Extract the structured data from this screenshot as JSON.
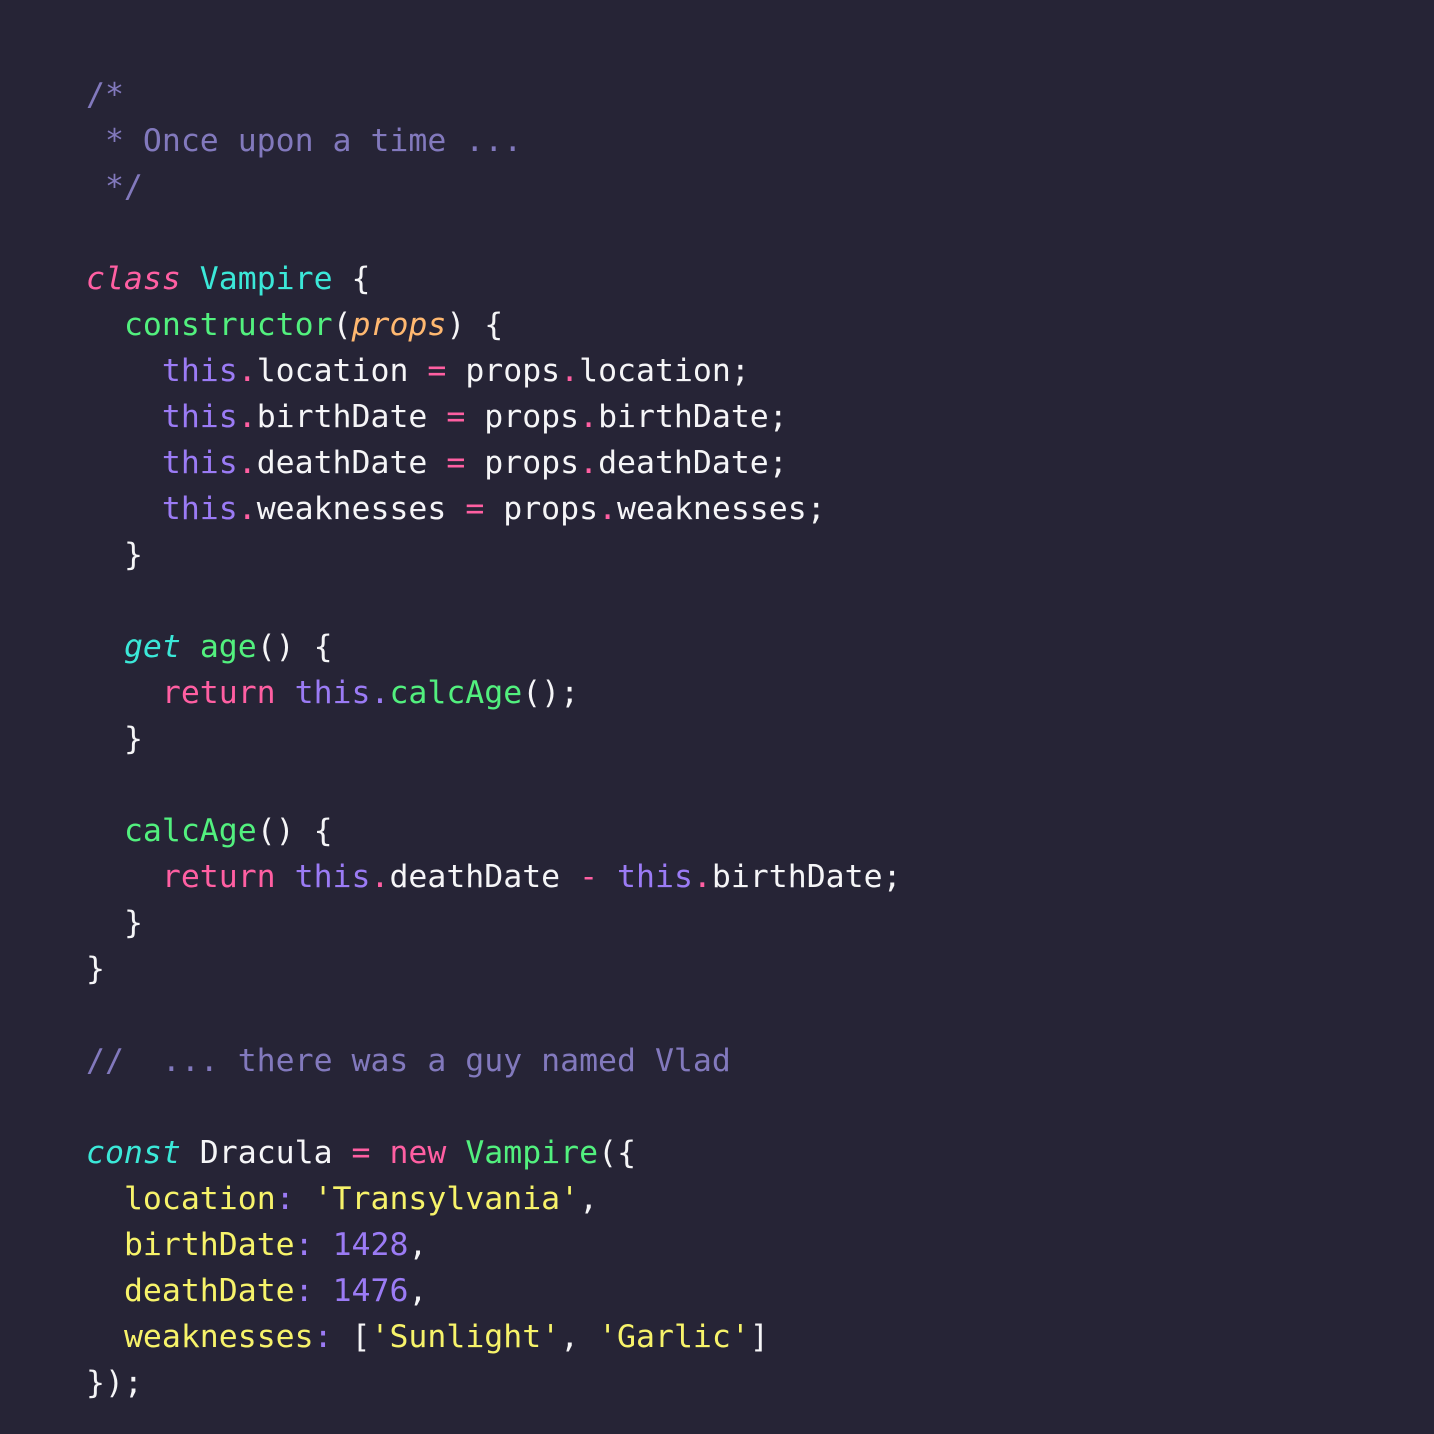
{
  "editor": {
    "language": "javascript",
    "theme_name": "dracula",
    "background_color": "#262436",
    "colors": {
      "comment": "#8279bd",
      "keyword_pink": "#ff5fa2",
      "keyword_cyan_italic": "#3be8d8",
      "class_name_cyan": "#3be8d8",
      "function_green": "#52f07e",
      "parameter_orange_italic": "#ffb870",
      "this_purple": "#9b7bf5",
      "number_purple": "#9b7bf5",
      "string_yellow": "#f7f36a",
      "key_yellow": "#f7f36a",
      "plain_white": "#f5f5f7"
    }
  },
  "code": {
    "lines": [
      {
        "id": "l1",
        "indent": 0,
        "tokens": [
          {
            "t": "/*",
            "c": "t-comment"
          }
        ]
      },
      {
        "id": "l2",
        "indent": 0,
        "tokens": [
          {
            "t": " * Once upon a time ...",
            "c": "t-comment"
          }
        ]
      },
      {
        "id": "l3",
        "indent": 0,
        "tokens": [
          {
            "t": " */",
            "c": "t-comment"
          }
        ]
      },
      {
        "id": "l4",
        "indent": 0,
        "tokens": []
      },
      {
        "id": "l5",
        "indent": 0,
        "tokens": [
          {
            "t": "class",
            "c": "t-kw-class"
          },
          {
            "t": " ",
            "c": "t-plain"
          },
          {
            "t": "Vampire",
            "c": "t-class"
          },
          {
            "t": " ",
            "c": "t-plain"
          },
          {
            "t": "{",
            "c": "t-punct"
          }
        ]
      },
      {
        "id": "l6",
        "indent": 1,
        "tokens": [
          {
            "t": "constructor",
            "c": "t-func"
          },
          {
            "t": "(",
            "c": "t-punct"
          },
          {
            "t": "props",
            "c": "t-param"
          },
          {
            "t": ")",
            "c": "t-punct"
          },
          {
            "t": " ",
            "c": "t-plain"
          },
          {
            "t": "{",
            "c": "t-punct"
          }
        ]
      },
      {
        "id": "l7",
        "indent": 2,
        "tokens": [
          {
            "t": "this",
            "c": "t-this"
          },
          {
            "t": ".",
            "c": "t-dot-pink"
          },
          {
            "t": "location",
            "c": "t-prop"
          },
          {
            "t": " ",
            "c": "t-plain"
          },
          {
            "t": "=",
            "c": "t-op"
          },
          {
            "t": " ",
            "c": "t-plain"
          },
          {
            "t": "props",
            "c": "t-prop"
          },
          {
            "t": ".",
            "c": "t-dot-pink"
          },
          {
            "t": "location",
            "c": "t-prop"
          },
          {
            "t": ";",
            "c": "t-punct"
          }
        ]
      },
      {
        "id": "l8",
        "indent": 2,
        "tokens": [
          {
            "t": "this",
            "c": "t-this"
          },
          {
            "t": ".",
            "c": "t-dot-pink"
          },
          {
            "t": "birthDate",
            "c": "t-prop"
          },
          {
            "t": " ",
            "c": "t-plain"
          },
          {
            "t": "=",
            "c": "t-op"
          },
          {
            "t": " ",
            "c": "t-plain"
          },
          {
            "t": "props",
            "c": "t-prop"
          },
          {
            "t": ".",
            "c": "t-dot-pink"
          },
          {
            "t": "birthDate",
            "c": "t-prop"
          },
          {
            "t": ";",
            "c": "t-punct"
          }
        ]
      },
      {
        "id": "l9",
        "indent": 2,
        "tokens": [
          {
            "t": "this",
            "c": "t-this"
          },
          {
            "t": ".",
            "c": "t-dot-pink"
          },
          {
            "t": "deathDate",
            "c": "t-prop"
          },
          {
            "t": " ",
            "c": "t-plain"
          },
          {
            "t": "=",
            "c": "t-op"
          },
          {
            "t": " ",
            "c": "t-plain"
          },
          {
            "t": "props",
            "c": "t-prop"
          },
          {
            "t": ".",
            "c": "t-dot-pink"
          },
          {
            "t": "deathDate",
            "c": "t-prop"
          },
          {
            "t": ";",
            "c": "t-punct"
          }
        ]
      },
      {
        "id": "l10",
        "indent": 2,
        "tokens": [
          {
            "t": "this",
            "c": "t-this"
          },
          {
            "t": ".",
            "c": "t-dot-pink"
          },
          {
            "t": "weaknesses",
            "c": "t-prop"
          },
          {
            "t": " ",
            "c": "t-plain"
          },
          {
            "t": "=",
            "c": "t-op"
          },
          {
            "t": " ",
            "c": "t-plain"
          },
          {
            "t": "props",
            "c": "t-prop"
          },
          {
            "t": ".",
            "c": "t-dot-pink"
          },
          {
            "t": "weaknesses",
            "c": "t-prop"
          },
          {
            "t": ";",
            "c": "t-punct"
          }
        ]
      },
      {
        "id": "l11",
        "indent": 1,
        "tokens": [
          {
            "t": "}",
            "c": "t-punct"
          }
        ]
      },
      {
        "id": "l12",
        "indent": 0,
        "tokens": []
      },
      {
        "id": "l13",
        "indent": 1,
        "tokens": [
          {
            "t": "get",
            "c": "t-kw-decl"
          },
          {
            "t": " ",
            "c": "t-plain"
          },
          {
            "t": "age",
            "c": "t-func"
          },
          {
            "t": "()",
            "c": "t-punct"
          },
          {
            "t": " ",
            "c": "t-plain"
          },
          {
            "t": "{",
            "c": "t-punct"
          }
        ]
      },
      {
        "id": "l14",
        "indent": 2,
        "tokens": [
          {
            "t": "return",
            "c": "t-keyword"
          },
          {
            "t": " ",
            "c": "t-plain"
          },
          {
            "t": "this",
            "c": "t-this"
          },
          {
            "t": ".",
            "c": "t-dot-purp"
          },
          {
            "t": "calcAge",
            "c": "t-func"
          },
          {
            "t": "()",
            "c": "t-punct"
          },
          {
            "t": ";",
            "c": "t-punct"
          }
        ]
      },
      {
        "id": "l15",
        "indent": 1,
        "tokens": [
          {
            "t": "}",
            "c": "t-punct"
          }
        ]
      },
      {
        "id": "l16",
        "indent": 0,
        "tokens": []
      },
      {
        "id": "l17",
        "indent": 1,
        "tokens": [
          {
            "t": "calcAge",
            "c": "t-func"
          },
          {
            "t": "()",
            "c": "t-punct"
          },
          {
            "t": " ",
            "c": "t-plain"
          },
          {
            "t": "{",
            "c": "t-punct"
          }
        ]
      },
      {
        "id": "l18",
        "indent": 2,
        "tokens": [
          {
            "t": "return",
            "c": "t-keyword"
          },
          {
            "t": " ",
            "c": "t-plain"
          },
          {
            "t": "this",
            "c": "t-this"
          },
          {
            "t": ".",
            "c": "t-dot-pink"
          },
          {
            "t": "deathDate",
            "c": "t-prop"
          },
          {
            "t": " ",
            "c": "t-plain"
          },
          {
            "t": "-",
            "c": "t-op"
          },
          {
            "t": " ",
            "c": "t-plain"
          },
          {
            "t": "this",
            "c": "t-this"
          },
          {
            "t": ".",
            "c": "t-dot-pink"
          },
          {
            "t": "birthDate",
            "c": "t-prop"
          },
          {
            "t": ";",
            "c": "t-punct"
          }
        ]
      },
      {
        "id": "l19",
        "indent": 1,
        "tokens": [
          {
            "t": "}",
            "c": "t-punct"
          }
        ]
      },
      {
        "id": "l20",
        "indent": 0,
        "tokens": [
          {
            "t": "}",
            "c": "t-punct"
          }
        ]
      },
      {
        "id": "l21",
        "indent": 0,
        "tokens": []
      },
      {
        "id": "l22",
        "indent": 0,
        "tokens": [
          {
            "t": "//  ... there was a guy named Vlad",
            "c": "t-comment"
          }
        ]
      },
      {
        "id": "l23",
        "indent": 0,
        "tokens": []
      },
      {
        "id": "l24",
        "indent": 0,
        "tokens": [
          {
            "t": "const",
            "c": "t-kw-decl"
          },
          {
            "t": " ",
            "c": "t-plain"
          },
          {
            "t": "Dracula",
            "c": "t-plain"
          },
          {
            "t": " ",
            "c": "t-plain"
          },
          {
            "t": "=",
            "c": "t-op"
          },
          {
            "t": " ",
            "c": "t-plain"
          },
          {
            "t": "new",
            "c": "t-keyword"
          },
          {
            "t": " ",
            "c": "t-plain"
          },
          {
            "t": "Vampire",
            "c": "t-func"
          },
          {
            "t": "({",
            "c": "t-punct"
          }
        ]
      },
      {
        "id": "l25",
        "indent": 1,
        "tokens": [
          {
            "t": "location",
            "c": "t-key"
          },
          {
            "t": ":",
            "c": "t-colon"
          },
          {
            "t": " ",
            "c": "t-plain"
          },
          {
            "t": "'Transylvania'",
            "c": "t-string"
          },
          {
            "t": ",",
            "c": "t-punct"
          }
        ]
      },
      {
        "id": "l26",
        "indent": 1,
        "tokens": [
          {
            "t": "birthDate",
            "c": "t-key"
          },
          {
            "t": ":",
            "c": "t-colon"
          },
          {
            "t": " ",
            "c": "t-plain"
          },
          {
            "t": "1428",
            "c": "t-number"
          },
          {
            "t": ",",
            "c": "t-punct"
          }
        ]
      },
      {
        "id": "l27",
        "indent": 1,
        "tokens": [
          {
            "t": "deathDate",
            "c": "t-key"
          },
          {
            "t": ":",
            "c": "t-colon"
          },
          {
            "t": " ",
            "c": "t-plain"
          },
          {
            "t": "1476",
            "c": "t-number"
          },
          {
            "t": ",",
            "c": "t-punct"
          }
        ]
      },
      {
        "id": "l28",
        "indent": 1,
        "tokens": [
          {
            "t": "weaknesses",
            "c": "t-key"
          },
          {
            "t": ":",
            "c": "t-colon"
          },
          {
            "t": " ",
            "c": "t-plain"
          },
          {
            "t": "[",
            "c": "t-punct"
          },
          {
            "t": "'Sunlight'",
            "c": "t-string"
          },
          {
            "t": ", ",
            "c": "t-punct"
          },
          {
            "t": "'Garlic'",
            "c": "t-string"
          },
          {
            "t": "]",
            "c": "t-punct"
          }
        ]
      },
      {
        "id": "l29",
        "indent": 0,
        "tokens": [
          {
            "t": "});",
            "c": "t-punct"
          }
        ]
      }
    ]
  },
  "program": {
    "class_name": "Vampire",
    "instance_name": "Dracula",
    "block_comment": "Once upon a time ...",
    "line_comment": "... there was a guy named Vlad",
    "constructor_parameter": "props",
    "assigned_properties": [
      "location",
      "birthDate",
      "deathDate",
      "weaknesses"
    ],
    "methods": [
      "age",
      "calcAge"
    ],
    "instance_values": {
      "location": "Transylvania",
      "birthDate": "1428",
      "deathDate": "1476",
      "weaknesses": [
        "Sunlight",
        "Garlic"
      ]
    }
  }
}
